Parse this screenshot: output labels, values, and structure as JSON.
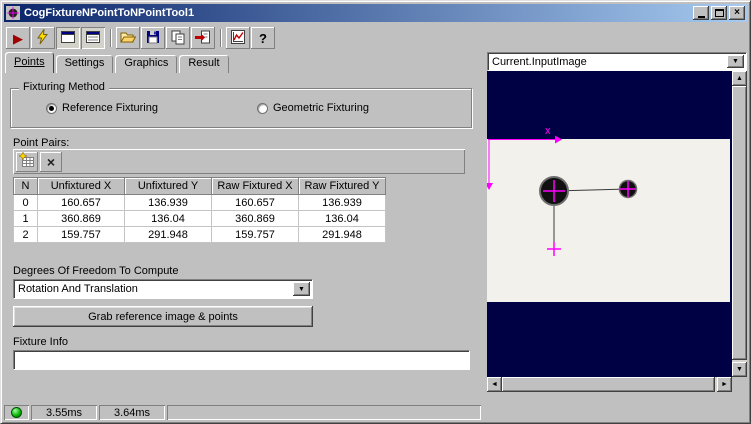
{
  "window": {
    "title": "CogFixtureNPointToNPointTool1"
  },
  "icons": {
    "run": "▶",
    "close": "×",
    "help": "?",
    "dropdown": "▼",
    "scroll_up": "▲",
    "scroll_down": "▼",
    "scroll_left": "◄",
    "scroll_right": "►",
    "delete": "×"
  },
  "tabs": [
    {
      "label": "Points",
      "active": "true"
    },
    {
      "label": "Settings",
      "active": "false"
    },
    {
      "label": "Graphics",
      "active": "false"
    },
    {
      "label": "Result",
      "active": "false"
    }
  ],
  "fixturing": {
    "legend": "Fixturing Method",
    "options": [
      {
        "label": "Reference Fixturing",
        "state": "checked"
      },
      {
        "label": "Geometric Fixturing",
        "state": "unchecked"
      }
    ]
  },
  "point_pairs": {
    "label": "Point Pairs:",
    "columns": [
      "N",
      "Unfixtured X",
      "Unfixtured Y",
      "Raw Fixtured X",
      "Raw Fixtured Y"
    ],
    "rows": [
      [
        "0",
        "160.657",
        "136.939",
        "160.657",
        "136.939"
      ],
      [
        "1",
        "360.869",
        "136.04",
        "360.869",
        "136.04"
      ],
      [
        "2",
        "159.757",
        "291.948",
        "159.757",
        "291.948"
      ]
    ]
  },
  "dof": {
    "label": "Degrees Of Freedom To Compute",
    "value": "Rotation And Translation"
  },
  "grab_button_label": "Grab reference image & points",
  "fixture_info": {
    "label": "Fixture Info",
    "value": ""
  },
  "image_panel": {
    "source": "Current.InputImage",
    "axis_x_label": "x",
    "background_color": "#000045",
    "marker_color": "#ff00ff"
  },
  "status": {
    "timings": [
      "3.55ms",
      "3.64ms"
    ]
  }
}
